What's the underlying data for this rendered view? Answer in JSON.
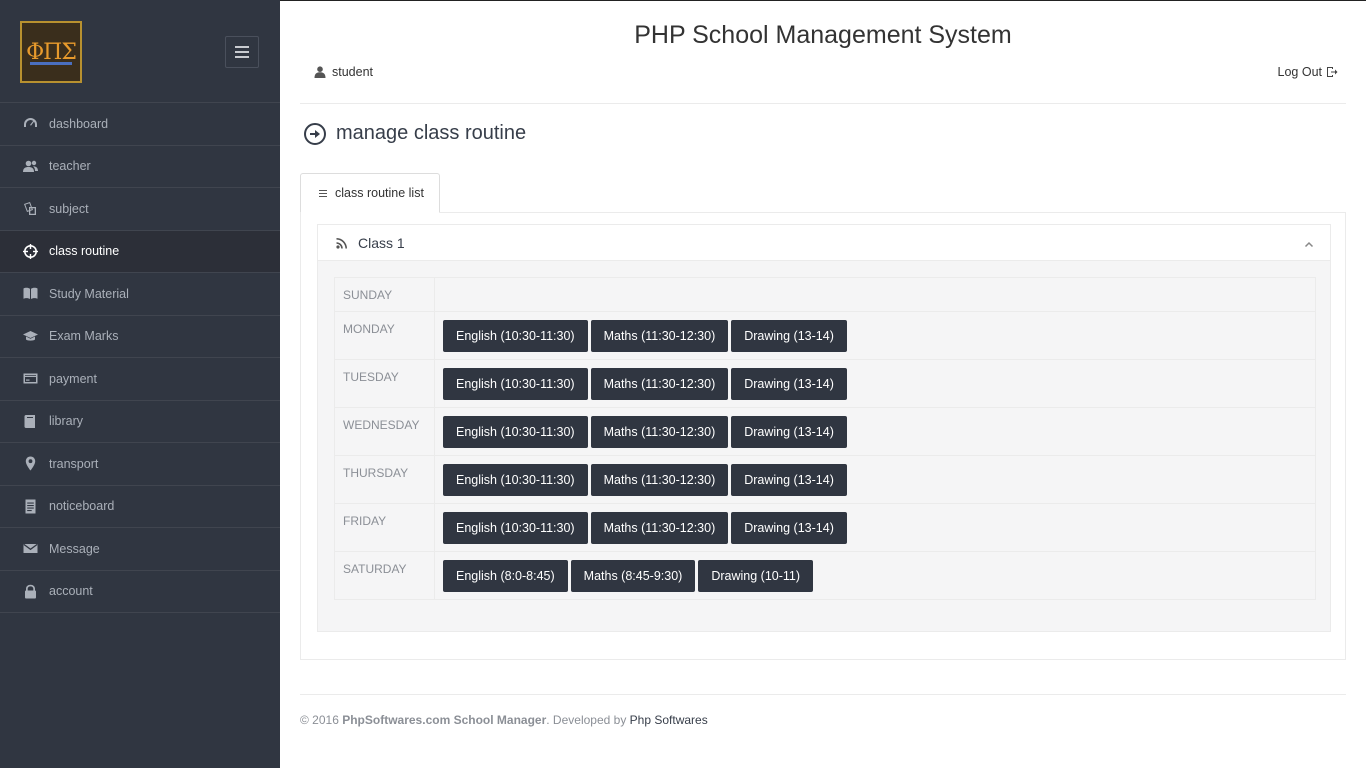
{
  "logo": {
    "text": "ΦΠΣ"
  },
  "sidebar": {
    "items": [
      {
        "label": "dashboard",
        "icon": "gauge-icon"
      },
      {
        "label": "teacher",
        "icon": "users-icon"
      },
      {
        "label": "subject",
        "icon": "docs-icon"
      },
      {
        "label": "class routine",
        "icon": "target-icon",
        "active": true
      },
      {
        "label": "Study Material",
        "icon": "book-icon"
      },
      {
        "label": "Exam Marks",
        "icon": "graduation-cap-icon"
      },
      {
        "label": "payment",
        "icon": "credit-card-icon"
      },
      {
        "label": "library",
        "icon": "library-book-icon"
      },
      {
        "label": "transport",
        "icon": "location-icon"
      },
      {
        "label": "noticeboard",
        "icon": "doc-text-icon"
      },
      {
        "label": "Message",
        "icon": "mail-icon"
      },
      {
        "label": "account",
        "icon": "lock-icon"
      }
    ]
  },
  "header": {
    "title": "PHP School Management System",
    "user": "student",
    "logout": "Log Out"
  },
  "page": {
    "title": "manage class routine"
  },
  "tabs": [
    {
      "label": "class routine list"
    }
  ],
  "panel": {
    "title": "Class 1"
  },
  "routine": [
    {
      "day": "SUNDAY",
      "slots": []
    },
    {
      "day": "MONDAY",
      "slots": [
        "English (10:30-11:30)",
        "Maths (11:30-12:30)",
        "Drawing (13-14)"
      ]
    },
    {
      "day": "TUESDAY",
      "slots": [
        "English (10:30-11:30)",
        "Maths (11:30-12:30)",
        "Drawing (13-14)"
      ]
    },
    {
      "day": "WEDNESDAY",
      "slots": [
        "English (10:30-11:30)",
        "Maths (11:30-12:30)",
        "Drawing (13-14)"
      ]
    },
    {
      "day": "THURSDAY",
      "slots": [
        "English (10:30-11:30)",
        "Maths (11:30-12:30)",
        "Drawing (13-14)"
      ]
    },
    {
      "day": "FRIDAY",
      "slots": [
        "English (10:30-11:30)",
        "Maths (11:30-12:30)",
        "Drawing (13-14)"
      ]
    },
    {
      "day": "SATURDAY",
      "slots": [
        "English (8:0-8:45)",
        "Maths (8:45-9:30)",
        "Drawing (10-11)"
      ]
    }
  ],
  "footer": {
    "copyright": "© 2016",
    "brand": "PhpSoftwares.com School Manager",
    "developed": ". Developed by",
    "developer": "Php Softwares"
  }
}
